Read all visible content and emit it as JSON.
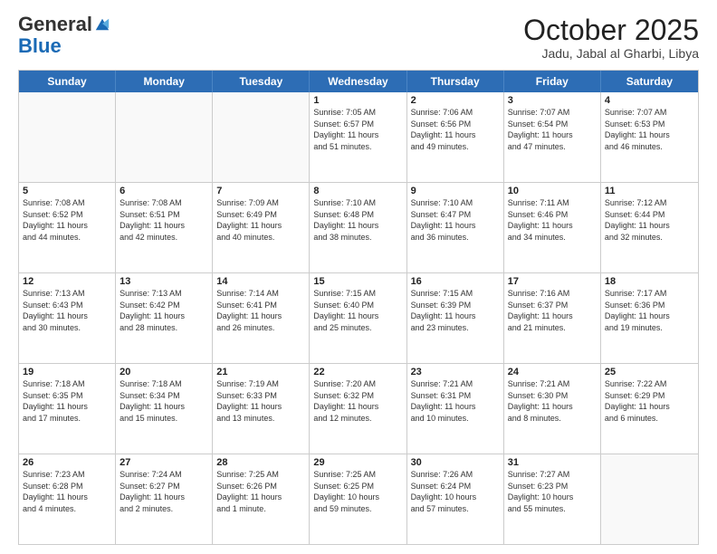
{
  "header": {
    "logo_general": "General",
    "logo_blue": "Blue",
    "month_title": "October 2025",
    "location": "Jadu, Jabal al Gharbi, Libya"
  },
  "days_of_week": [
    "Sunday",
    "Monday",
    "Tuesday",
    "Wednesday",
    "Thursday",
    "Friday",
    "Saturday"
  ],
  "weeks": [
    [
      {
        "day": "",
        "info": ""
      },
      {
        "day": "",
        "info": ""
      },
      {
        "day": "",
        "info": ""
      },
      {
        "day": "1",
        "info": "Sunrise: 7:05 AM\nSunset: 6:57 PM\nDaylight: 11 hours\nand 51 minutes."
      },
      {
        "day": "2",
        "info": "Sunrise: 7:06 AM\nSunset: 6:56 PM\nDaylight: 11 hours\nand 49 minutes."
      },
      {
        "day": "3",
        "info": "Sunrise: 7:07 AM\nSunset: 6:54 PM\nDaylight: 11 hours\nand 47 minutes."
      },
      {
        "day": "4",
        "info": "Sunrise: 7:07 AM\nSunset: 6:53 PM\nDaylight: 11 hours\nand 46 minutes."
      }
    ],
    [
      {
        "day": "5",
        "info": "Sunrise: 7:08 AM\nSunset: 6:52 PM\nDaylight: 11 hours\nand 44 minutes."
      },
      {
        "day": "6",
        "info": "Sunrise: 7:08 AM\nSunset: 6:51 PM\nDaylight: 11 hours\nand 42 minutes."
      },
      {
        "day": "7",
        "info": "Sunrise: 7:09 AM\nSunset: 6:49 PM\nDaylight: 11 hours\nand 40 minutes."
      },
      {
        "day": "8",
        "info": "Sunrise: 7:10 AM\nSunset: 6:48 PM\nDaylight: 11 hours\nand 38 minutes."
      },
      {
        "day": "9",
        "info": "Sunrise: 7:10 AM\nSunset: 6:47 PM\nDaylight: 11 hours\nand 36 minutes."
      },
      {
        "day": "10",
        "info": "Sunrise: 7:11 AM\nSunset: 6:46 PM\nDaylight: 11 hours\nand 34 minutes."
      },
      {
        "day": "11",
        "info": "Sunrise: 7:12 AM\nSunset: 6:44 PM\nDaylight: 11 hours\nand 32 minutes."
      }
    ],
    [
      {
        "day": "12",
        "info": "Sunrise: 7:13 AM\nSunset: 6:43 PM\nDaylight: 11 hours\nand 30 minutes."
      },
      {
        "day": "13",
        "info": "Sunrise: 7:13 AM\nSunset: 6:42 PM\nDaylight: 11 hours\nand 28 minutes."
      },
      {
        "day": "14",
        "info": "Sunrise: 7:14 AM\nSunset: 6:41 PM\nDaylight: 11 hours\nand 26 minutes."
      },
      {
        "day": "15",
        "info": "Sunrise: 7:15 AM\nSunset: 6:40 PM\nDaylight: 11 hours\nand 25 minutes."
      },
      {
        "day": "16",
        "info": "Sunrise: 7:15 AM\nSunset: 6:39 PM\nDaylight: 11 hours\nand 23 minutes."
      },
      {
        "day": "17",
        "info": "Sunrise: 7:16 AM\nSunset: 6:37 PM\nDaylight: 11 hours\nand 21 minutes."
      },
      {
        "day": "18",
        "info": "Sunrise: 7:17 AM\nSunset: 6:36 PM\nDaylight: 11 hours\nand 19 minutes."
      }
    ],
    [
      {
        "day": "19",
        "info": "Sunrise: 7:18 AM\nSunset: 6:35 PM\nDaylight: 11 hours\nand 17 minutes."
      },
      {
        "day": "20",
        "info": "Sunrise: 7:18 AM\nSunset: 6:34 PM\nDaylight: 11 hours\nand 15 minutes."
      },
      {
        "day": "21",
        "info": "Sunrise: 7:19 AM\nSunset: 6:33 PM\nDaylight: 11 hours\nand 13 minutes."
      },
      {
        "day": "22",
        "info": "Sunrise: 7:20 AM\nSunset: 6:32 PM\nDaylight: 11 hours\nand 12 minutes."
      },
      {
        "day": "23",
        "info": "Sunrise: 7:21 AM\nSunset: 6:31 PM\nDaylight: 11 hours\nand 10 minutes."
      },
      {
        "day": "24",
        "info": "Sunrise: 7:21 AM\nSunset: 6:30 PM\nDaylight: 11 hours\nand 8 minutes."
      },
      {
        "day": "25",
        "info": "Sunrise: 7:22 AM\nSunset: 6:29 PM\nDaylight: 11 hours\nand 6 minutes."
      }
    ],
    [
      {
        "day": "26",
        "info": "Sunrise: 7:23 AM\nSunset: 6:28 PM\nDaylight: 11 hours\nand 4 minutes."
      },
      {
        "day": "27",
        "info": "Sunrise: 7:24 AM\nSunset: 6:27 PM\nDaylight: 11 hours\nand 2 minutes."
      },
      {
        "day": "28",
        "info": "Sunrise: 7:25 AM\nSunset: 6:26 PM\nDaylight: 11 hours\nand 1 minute."
      },
      {
        "day": "29",
        "info": "Sunrise: 7:25 AM\nSunset: 6:25 PM\nDaylight: 10 hours\nand 59 minutes."
      },
      {
        "day": "30",
        "info": "Sunrise: 7:26 AM\nSunset: 6:24 PM\nDaylight: 10 hours\nand 57 minutes."
      },
      {
        "day": "31",
        "info": "Sunrise: 7:27 AM\nSunset: 6:23 PM\nDaylight: 10 hours\nand 55 minutes."
      },
      {
        "day": "",
        "info": ""
      }
    ]
  ]
}
